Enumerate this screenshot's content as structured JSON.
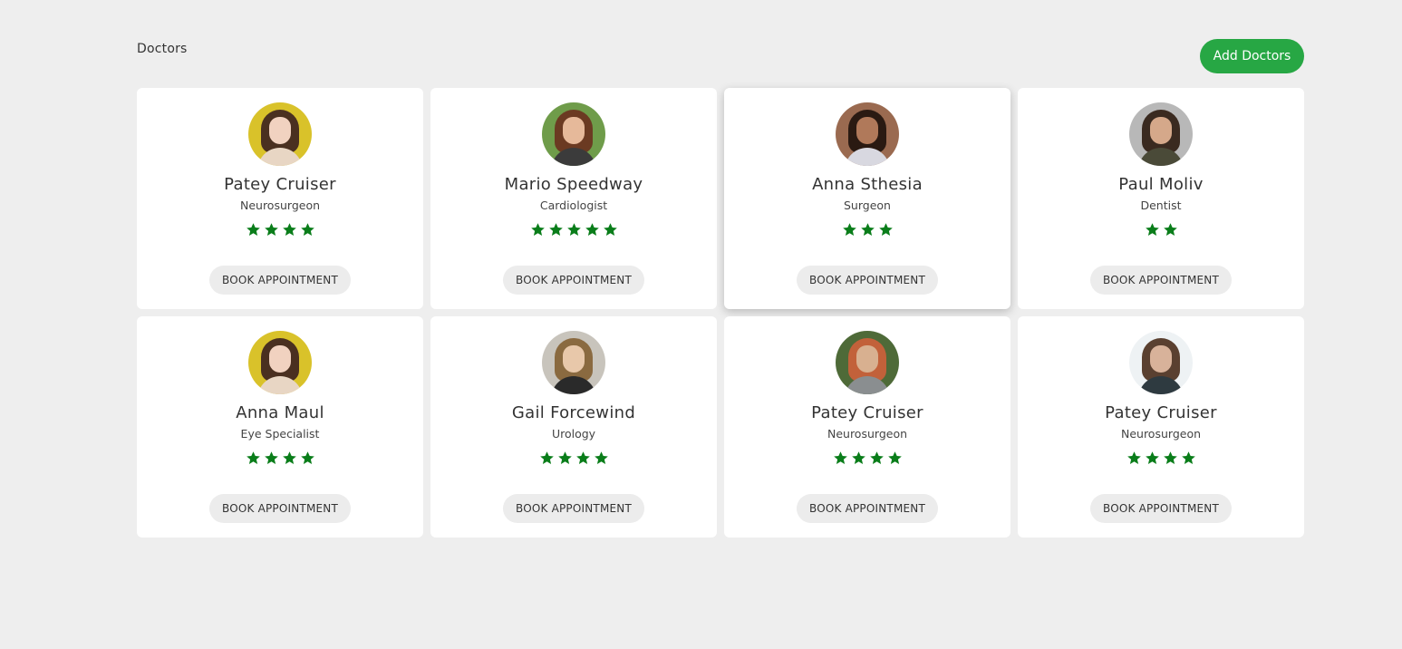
{
  "header": {
    "title": "Doctors",
    "add_button_label": "Add Doctors"
  },
  "colors": {
    "accent": "#27a744",
    "star": "#0a7d1a"
  },
  "doctors": [
    {
      "name": "Patey Cruiser",
      "specialty": "Neurosurgeon",
      "rating": 4,
      "button_label": "BOOK APPOINTMENT",
      "avatar": {
        "bg": "#d9c22a",
        "hair": "#4a3020",
        "skin": "#f1d2c0",
        "body": "#e8d6c4"
      }
    },
    {
      "name": "Mario Speedway",
      "specialty": "Cardiologist",
      "rating": 5,
      "button_label": "BOOK APPOINTMENT",
      "avatar": {
        "bg": "#6f9c4a",
        "hair": "#6b3a22",
        "skin": "#e6b99a",
        "body": "#3b3b3b"
      }
    },
    {
      "name": "Anna Sthesia",
      "specialty": "Surgeon",
      "rating": 3,
      "button_label": "BOOK APPOINTMENT",
      "elevated": true,
      "avatar": {
        "bg": "#9a6a50",
        "hair": "#2a1a12",
        "skin": "#b0795a",
        "body": "#d8d8e0"
      }
    },
    {
      "name": "Paul Moliv",
      "specialty": "Dentist",
      "rating": 2,
      "button_label": "BOOK APPOINTMENT",
      "avatar": {
        "bg": "#b8b8b8",
        "hair": "#3a2a20",
        "skin": "#d5a88a",
        "body": "#4a4a38"
      }
    },
    {
      "name": "Anna Maul",
      "specialty": "Eye Specialist",
      "rating": 4,
      "button_label": "BOOK APPOINTMENT",
      "avatar": {
        "bg": "#d9c22a",
        "hair": "#4a3020",
        "skin": "#f1d2c0",
        "body": "#e8d6c4"
      }
    },
    {
      "name": "Gail Forcewind",
      "specialty": "Urology",
      "rating": 4,
      "button_label": "BOOK APPOINTMENT",
      "avatar": {
        "bg": "#c8c4bc",
        "hair": "#8a6a40",
        "skin": "#e8c8aa",
        "body": "#2a2a2a"
      }
    },
    {
      "name": "Patey Cruiser",
      "specialty": "Neurosurgeon",
      "rating": 4,
      "button_label": "BOOK APPOINTMENT",
      "avatar": {
        "bg": "#4e6a38",
        "hair": "#c2613a",
        "skin": "#d8b090",
        "body": "#8a8e90"
      }
    },
    {
      "name": "Patey Cruiser",
      "specialty": "Neurosurgeon",
      "rating": 4,
      "button_label": "BOOK APPOINTMENT",
      "avatar": {
        "bg": "#eef2f4",
        "hair": "#5a4030",
        "skin": "#d8b29a",
        "body": "#2e3a40"
      }
    }
  ]
}
